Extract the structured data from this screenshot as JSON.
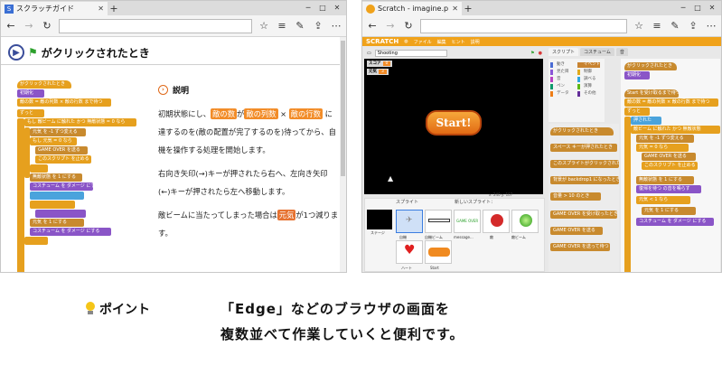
{
  "left_browser": {
    "tab_title": "スクラッチガイド",
    "favicon_letter": "S",
    "section_title": "がクリックされたとき",
    "explain_title": "説明",
    "para1": {
      "t1": "初期状態にし、",
      "hl_a": "敵の数",
      "t2": "が",
      "hl_b": "敵の列数",
      "t3": "×",
      "hl_c": "敵の行数",
      "t4": "に達するのを(敵の配置が完了するのを)待ってから、自機を操作する処理を開始します。"
    },
    "para2": "右向き矢印(→)キーが押されたら右へ、左向き矢印(←)キーが押されたら左へ移動します。",
    "para3": {
      "t1": "敵ビームに当たってしまった場合は",
      "hl": "元気",
      "t2": "が1つ減ります。"
    },
    "script_blocks": [
      "がクリックされたとき",
      "初期化",
      "敵の数 = 敵の列数 × 敵の行数 まで待つ",
      "ずっと",
      "もし 敵ビーム に触れた かつ 無敵状態 = 0 なら",
      "元気 を -1 ずつ変える",
      "もし 元気 = 0 なら",
      "GAME OVER を送る",
      "このスクリプト を止める",
      "無敵状態 を 1 にする",
      "元気 を 1 にする",
      "コスチューム を ダメージ にする"
    ]
  },
  "right_browser": {
    "tab_title": "Scratch - imagine.progr",
    "menu": [
      "ファイル",
      "編集",
      "ヒント",
      "説明"
    ],
    "project_title": "Shooting",
    "stage_vars": [
      {
        "name": "スコア",
        "value": "0"
      },
      {
        "name": "元気",
        "value": "3"
      }
    ],
    "start_label": "Start!",
    "tabs": [
      "スクリプト",
      "コスチューム",
      "音"
    ],
    "categories": [
      {
        "name": "動き",
        "color": "#4a6cd4"
      },
      {
        "name": "見た目",
        "color": "#8a55d7"
      },
      {
        "name": "音",
        "color": "#bb42c3"
      },
      {
        "name": "ペン",
        "color": "#0e9a6c"
      },
      {
        "name": "データ",
        "color": "#ee7d16"
      },
      {
        "name": "イベント",
        "color": "#c88330"
      },
      {
        "name": "制御",
        "color": "#e1a91a"
      },
      {
        "name": "調べる",
        "color": "#2ca5e2"
      },
      {
        "name": "演算",
        "color": "#5cb712"
      },
      {
        "name": "その他",
        "color": "#632d99"
      }
    ],
    "sprites_label": "スプライト",
    "new_sprite_label": "新しいスプライト：",
    "stage_label": "ステージ",
    "sprite_names": [
      "自機",
      "自機ビーム",
      "message...",
      "敵",
      "敵ビーム",
      "ハート",
      "Start"
    ],
    "coords": "x: 240  y: 107",
    "palette_blocks": [
      "がクリックされたとき",
      "スペース キーが押されたとき",
      "このスプライトがクリックされたとき",
      "背景が backdrop1 になったとき",
      "音量 > 10 のとき",
      "GAME OVER を受け取ったとき",
      "GAME OVER を送る",
      "GAME OVER を送って待つ"
    ],
    "script_blocks": [
      "がクリックされたとき",
      "初期化",
      "Start を受け取るまで待つ",
      "敵の数 = 敵の列数 × 敵の行数 まで待つ",
      "ずっと",
      "押された",
      "敵ビーム に触れた かつ 無敵状態",
      "元気 を -1 ずつ変える",
      "元気 = 0 なら",
      "GAME OVER を送る",
      "このスクリプト を止める",
      "無敵状態 を 1 にする",
      "復帰を待つ の音を鳴らす",
      "元気 < 1 なら",
      "元気 を 1 にする",
      "コスチューム を ダメージ にする"
    ]
  },
  "tip": {
    "label": "ポイント",
    "line1": "「Edge」などのブラウザの画面を",
    "line2": "複数並べて作業していくと便利です。"
  },
  "colors": {
    "scratch_orange": "#f0a21a",
    "highlight_orange": "#f28c28",
    "accent_blue": "#3a4d9a"
  }
}
